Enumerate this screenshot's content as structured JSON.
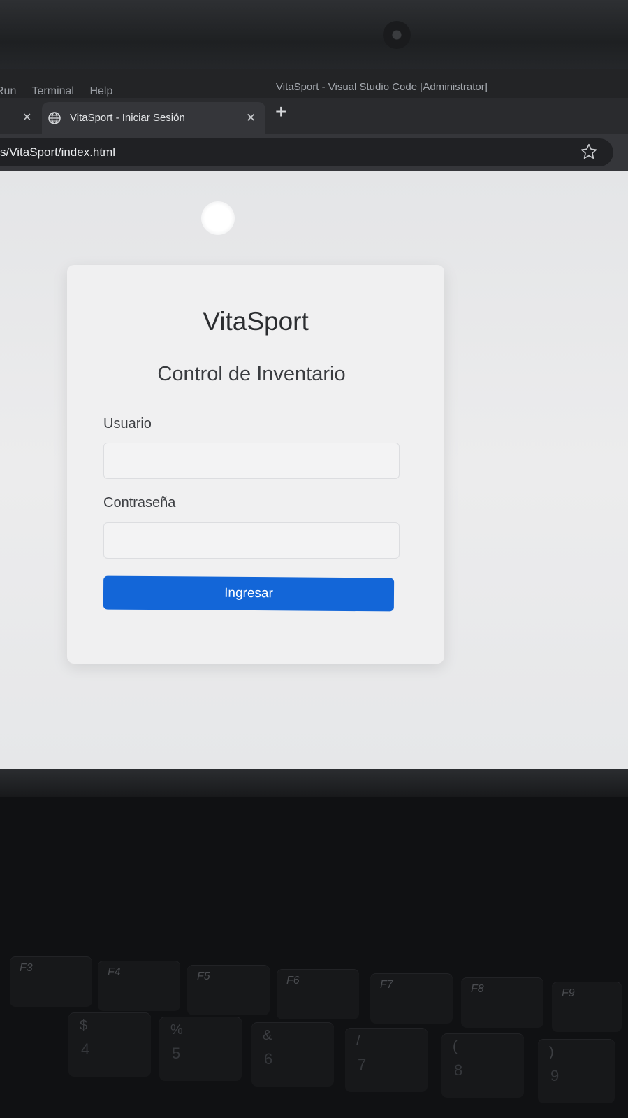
{
  "vscode": {
    "menu": [
      "Run",
      "Terminal",
      "Help"
    ],
    "window_title": "VitaSport - Visual Studio Code [Administrator]"
  },
  "browser": {
    "tab": {
      "title": "VitaSport - Iniciar Sesión",
      "icon": "globe-icon"
    },
    "address": "s/VitaSport/index.html"
  },
  "login": {
    "brand": "VitaSport",
    "subtitle": "Control de Inventario",
    "username_label": "Usuario",
    "username_value": "",
    "password_label": "Contraseña",
    "password_value": "",
    "submit_label": "Ingresar",
    "accent_color": "#1366d8"
  },
  "keyboard": {
    "function_keys": [
      "F3",
      "F4",
      "F5",
      "F6",
      "F7",
      "F8",
      "F9"
    ],
    "number_keys": [
      {
        "shift": "$",
        "main": "4"
      },
      {
        "shift": "%",
        "main": "5"
      },
      {
        "shift": "&",
        "main": "6"
      },
      {
        "shift": "/",
        "main": "7"
      },
      {
        "shift": "(",
        "main": "8"
      },
      {
        "shift": ")",
        "main": "9"
      }
    ]
  }
}
